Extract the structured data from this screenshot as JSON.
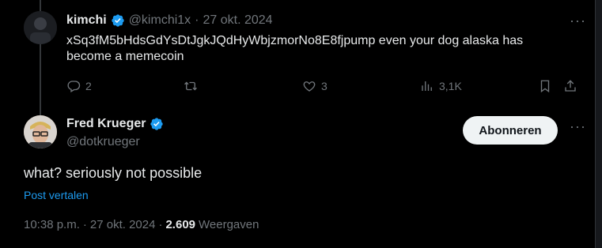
{
  "reply": {
    "name": "kimchi",
    "handle": "@kimchi1x",
    "separator": "·",
    "date": "27 okt. 2024",
    "text": "xSq3fM5bHdsGdYsDtJgkJQdHyWbjzmorNo8E8fjpump even your dog alaska has become a memecoin",
    "stats": {
      "replies": "2",
      "likes": "3",
      "views": "3,1K"
    }
  },
  "tweet": {
    "name": "Fred Krueger",
    "handle": "@dotkrueger",
    "follow_label": "Abonneren",
    "text": "what? seriously not possible",
    "translate_label": "Post vertalen",
    "time": "10:38 p.m.",
    "dot": "·",
    "date": "27 okt. 2024",
    "dot2": "·",
    "views_count": "2.609",
    "views_label": "Weergaven"
  },
  "icons": {
    "more": "more-horizontal-icon",
    "verified": "verified-badge-icon",
    "reply": "reply-icon",
    "repost": "repost-icon",
    "like": "heart-icon",
    "views": "views-chart-icon",
    "bookmark": "bookmark-icon",
    "share": "share-icon"
  },
  "colors": {
    "accent": "#1d9bf0",
    "muted": "#71767b",
    "text": "#e7e9ea",
    "background": "#000000"
  }
}
